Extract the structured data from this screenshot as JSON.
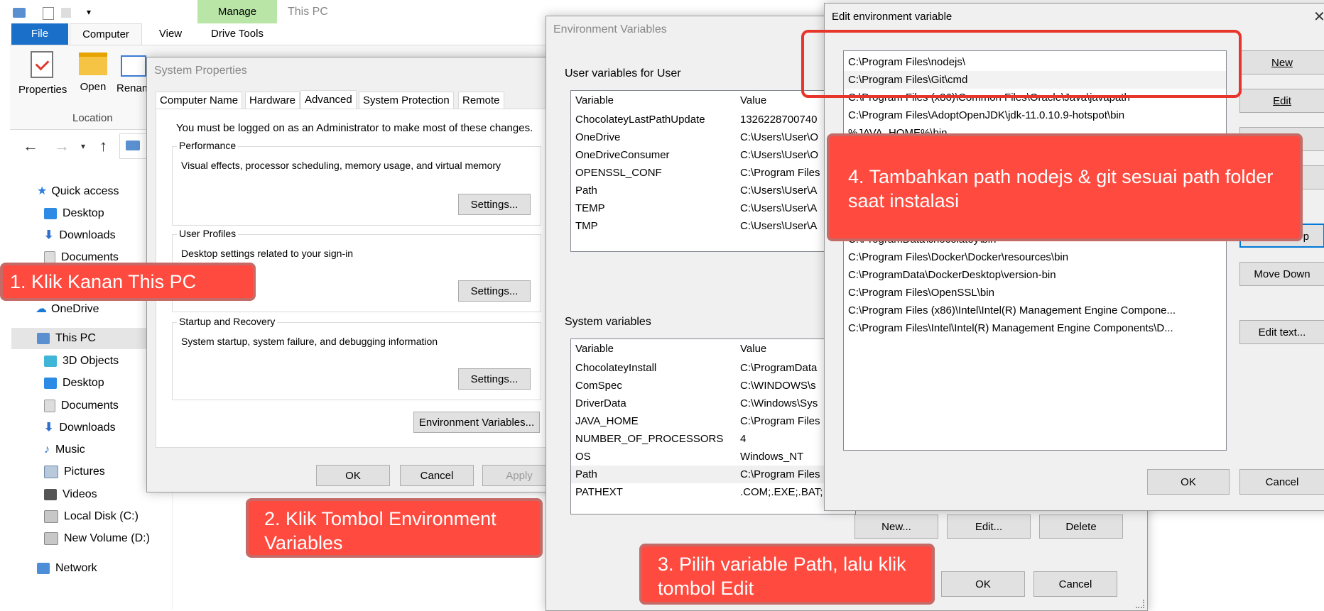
{
  "explorer": {
    "ribbon_tabs": [
      "File",
      "Computer",
      "View"
    ],
    "manage_label": "Manage",
    "drive_tools_label": "Drive Tools",
    "window_title": "This PC",
    "ribbon_buttons": [
      "Properties",
      "Open",
      "Renam"
    ],
    "location_group": "Location",
    "nav": {
      "quick_access": "Quick access",
      "quick_items": [
        "Desktop",
        "Downloads",
        "Documents"
      ],
      "onedrive": "OneDrive",
      "this_pc": "This PC",
      "pc_items": [
        "3D Objects",
        "Desktop",
        "Documents",
        "Downloads",
        "Music",
        "Pictures",
        "Videos",
        "Local Disk (C:)",
        "New Volume (D:)"
      ],
      "network": "Network"
    }
  },
  "system_properties": {
    "title": "System Properties",
    "tabs": [
      "Computer Name",
      "Hardware",
      "Advanced",
      "System Protection",
      "Remote"
    ],
    "active_tab": "Advanced",
    "admin_note": "You must be logged on as an Administrator to make most of these changes.",
    "performance": {
      "label": "Performance",
      "desc": "Visual effects, processor scheduling, memory usage, and virtual memory",
      "button": "Settings..."
    },
    "user_profiles": {
      "label": "User Profiles",
      "desc": "Desktop settings related to your sign-in",
      "button": "Settings..."
    },
    "startup": {
      "label": "Startup and Recovery",
      "desc": "System startup, system failure, and debugging information",
      "button": "Settings..."
    },
    "env_button": "Environment Variables...",
    "ok": "OK",
    "cancel": "Cancel",
    "apply": "Apply"
  },
  "env_vars": {
    "title": "Environment Variables",
    "user_label": "User variables for User",
    "headers": [
      "Variable",
      "Value"
    ],
    "user_rows": [
      [
        "ChocolateyLastPathUpdate",
        "1326228700740"
      ],
      [
        "OneDrive",
        "C:\\Users\\User\\O"
      ],
      [
        "OneDriveConsumer",
        "C:\\Users\\User\\O"
      ],
      [
        "OPENSSL_CONF",
        "C:\\Program Files"
      ],
      [
        "Path",
        "C:\\Users\\User\\A"
      ],
      [
        "TEMP",
        "C:\\Users\\User\\A"
      ],
      [
        "TMP",
        "C:\\Users\\User\\A"
      ]
    ],
    "system_label": "System variables",
    "system_rows": [
      [
        "ChocolateyInstall",
        "C:\\ProgramData"
      ],
      [
        "ComSpec",
        "C:\\WINDOWS\\s"
      ],
      [
        "DriverData",
        "C:\\Windows\\Sys"
      ],
      [
        "JAVA_HOME",
        "C:\\Program Files"
      ],
      [
        "NUMBER_OF_PROCESSORS",
        "4"
      ],
      [
        "OS",
        "Windows_NT"
      ],
      [
        "Path",
        "C:\\Program Files"
      ],
      [
        "PATHEXT",
        ".COM;.EXE;.BAT;"
      ]
    ],
    "new_btn": "New...",
    "edit_btn": "Edit...",
    "delete_btn": "Delete",
    "ok": "OK",
    "cancel": "Cancel"
  },
  "edit_env": {
    "title": "Edit environment variable",
    "paths": [
      "C:\\Program Files\\nodejs\\",
      "C:\\Program Files\\Git\\cmd",
      "C:\\Program Files (x86)\\Common Files\\Oracle\\Java\\javapath",
      "C:\\Program Files\\AdoptOpenJDK\\jdk-11.0.10.9-hotspot\\bin",
      "%JAVA_HOME%\\bin",
      "C:\\ProgramData\\chocolatey\\bin",
      "C:\\Program Files\\Docker\\Docker\\resources\\bin",
      "C:\\ProgramData\\DockerDesktop\\version-bin",
      "C:\\Program Files\\OpenSSL\\bin",
      "C:\\Program Files (x86)\\Intel\\Intel(R) Management Engine Compone...",
      "C:\\Program Files\\Intel\\Intel(R) Management Engine Components\\D..."
    ],
    "buttons": {
      "new": "New",
      "edit": "Edit",
      "move_up_partial": "p",
      "move_down": "Move Down",
      "edit_text": "Edit text..."
    },
    "ok": "OK",
    "cancel": "Cancel"
  },
  "annotations": {
    "step1": "1. Klik Kanan This PC",
    "step2": "2. Klik Tombol Environment Variables",
    "step3": "3. Pilih variable Path, lalu klik tombol Edit",
    "step4": "4. Tambahkan path nodejs & git sesuai path folder saat instalasi"
  },
  "colors": {
    "annotation_red": "#ff4a3f",
    "highlight_box": "#e8352b",
    "file_tab_blue": "#1a6fc9",
    "manage_green": "#b9e5a7"
  }
}
